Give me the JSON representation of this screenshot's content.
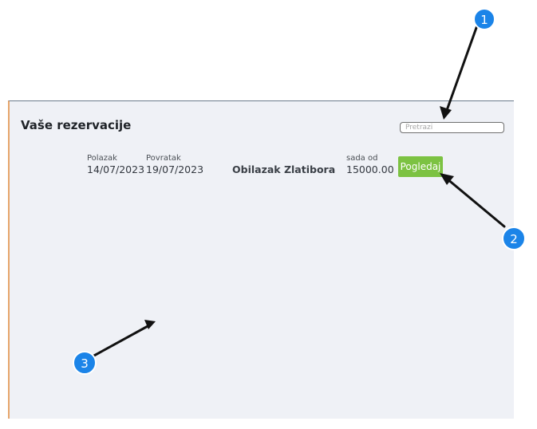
{
  "page": {
    "title": "Vaše rezervacije"
  },
  "search": {
    "placeholder": "Pretrazi",
    "value": ""
  },
  "reservations": [
    {
      "departure_label": "Polazak",
      "departure_date": "14/07/2023",
      "return_label": "Povratak",
      "return_date": "19/07/2023",
      "tour_name": "Obilazak Zlatibora",
      "price_label": "sada od",
      "price": "15000.00",
      "view_button_label": "Pogledaj"
    }
  ],
  "annotations": {
    "badges": [
      "1",
      "2",
      "3"
    ],
    "badge_color": "#1b84e8"
  },
  "colors": {
    "panel_background": "#eff1f6",
    "button_background": "#7cc242",
    "panel_left_border": "#e6a56b"
  }
}
